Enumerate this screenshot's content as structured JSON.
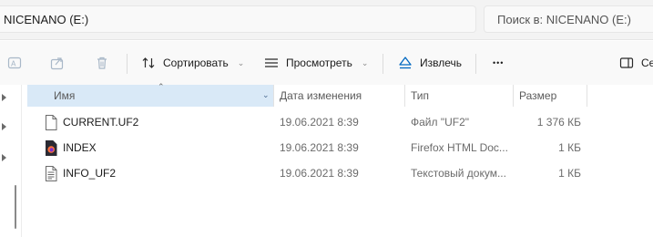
{
  "address": {
    "path": "NICENANO (E:)"
  },
  "search": {
    "placeholder": "Поиск в: NICENANO (E:)"
  },
  "toolbar": {
    "sort_label": "Сортировать",
    "view_label": "Просмотреть",
    "eject_label": "Извлечь",
    "more_label": "•••",
    "details_label": "Се"
  },
  "columns": {
    "name": "Имя",
    "date": "Дата изменения",
    "type": "Тип",
    "size": "Размер"
  },
  "files": [
    {
      "name": "CURRENT.UF2",
      "date": "19.06.2021 8:39",
      "type": "Файл \"UF2\"",
      "size": "1 376 КБ",
      "icon": "file-icon"
    },
    {
      "name": "INDEX",
      "date": "19.06.2021 8:39",
      "type": "Firefox HTML Doc...",
      "size": "1 КБ",
      "icon": "firefox-html-icon"
    },
    {
      "name": "INFO_UF2",
      "date": "19.06.2021 8:39",
      "type": "Текстовый докум...",
      "size": "1 КБ",
      "icon": "text-document-icon"
    }
  ],
  "colors": {
    "selected_header": "#d9e9f7",
    "accent": "#0067c0"
  }
}
